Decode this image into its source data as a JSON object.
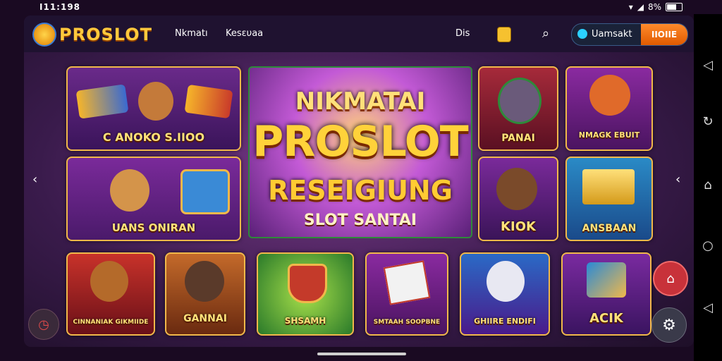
{
  "status": {
    "time": "I11:198",
    "battery": "8%"
  },
  "header": {
    "logo": "PROSLOT",
    "nav": [
      "Nkmatı",
      "Kesευaa"
    ],
    "extra": "Dis",
    "username": "Uamsakt",
    "login_button": "IIOIIE"
  },
  "hero": {
    "line1": "NIKMATAI",
    "line2": "PROSLOT",
    "line3": "RESEIGIUNG",
    "line4": "SLOT SANTAI"
  },
  "tiles": {
    "t1": "C ANOKO S.IIOO",
    "t2": "UANS ONIRAN",
    "t3": "PANAI",
    "t4": "NMAGK EBUIT",
    "t5": "KIOK",
    "t6": "ANSBAAN",
    "b1": "CINNANIAK GIKMIIDE",
    "b2": "GANNAI",
    "b3": "SHSAMH",
    "b4": "SMTAAH SOOPBNE",
    "b5": "GHIIRE ENDIFI",
    "b6": "ACIK"
  },
  "colors": {
    "accent": "#ffc93c",
    "login": "#ff8a2b",
    "border": "#f1b84a"
  },
  "icons": [
    "search-icon",
    "coin-icon",
    "settings-icon",
    "camera-icon",
    "back-icon",
    "home-icon"
  ]
}
